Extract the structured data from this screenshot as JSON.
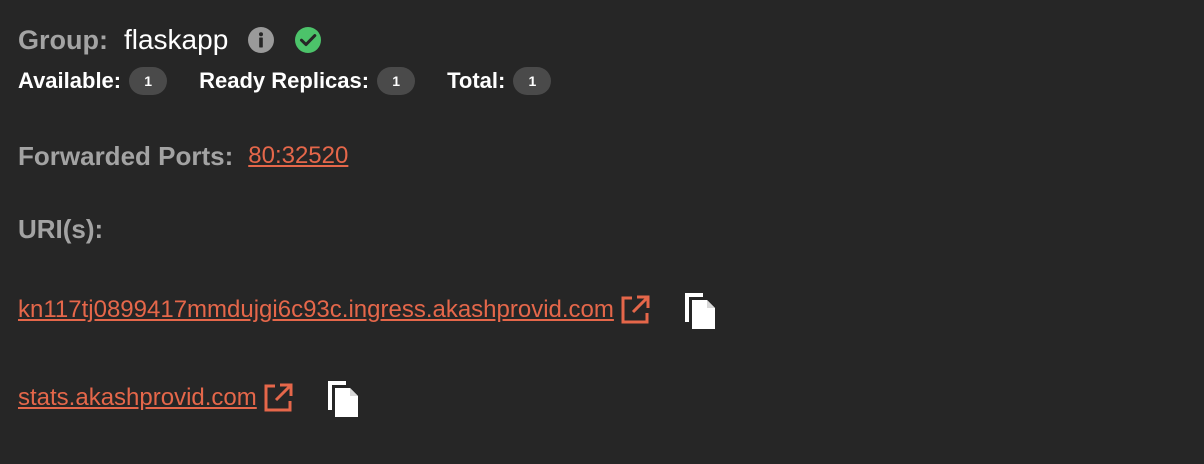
{
  "group": {
    "label": "Group:",
    "name": "flaskapp",
    "status": "ok"
  },
  "stats": {
    "available_label": "Available:",
    "available_value": "1",
    "ready_label": "Ready Replicas:",
    "ready_value": "1",
    "total_label": "Total:",
    "total_value": "1"
  },
  "ports": {
    "label": "Forwarded Ports:",
    "value": "80:32520"
  },
  "uris": {
    "label": "URI(s):",
    "items": [
      {
        "url": "kn117tj0899417mmdujgi6c93c.ingress.akashprovid.com"
      },
      {
        "url": "stats.akashprovid.com"
      }
    ]
  },
  "colors": {
    "background": "#262626",
    "link": "#e5674a",
    "muted_label": "#a3a3a3",
    "badge_bg": "#4a4a4a",
    "success": "#4cc36a"
  },
  "icons": {
    "info": "info-icon",
    "status": "check-circle-icon",
    "external": "external-link-icon",
    "copy": "copy-icon"
  }
}
